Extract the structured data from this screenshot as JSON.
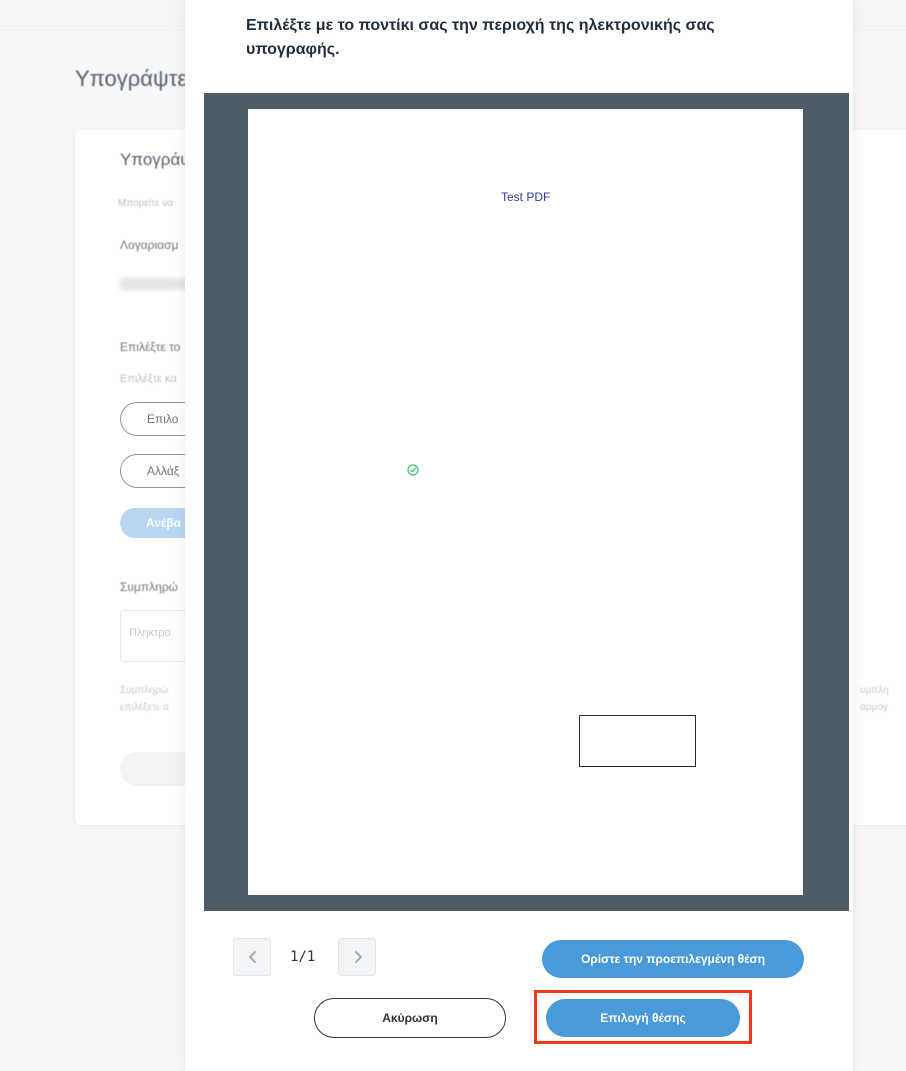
{
  "background": {
    "page_title": "Υπογράψτε",
    "card_heading": "Υπογράψ",
    "card_subtitle": "Μπορείτε να",
    "account_label": "Λογαριασμ",
    "select_label": "Επιλέξτε το",
    "select_sublabel": "Επιλέξτε κα",
    "btn_select": "Επιλο",
    "btn_change": "Αλλάξ",
    "btn_upload": "Ανέβα",
    "complete_label": "Συμπληρώ",
    "input_placeholder": "Πληκτρο",
    "para_line1": "Συμπληρώ",
    "para_line2": "επιλέξετε α",
    "right_para_line1": "υμπλη",
    "right_para_line2": "αρμογ"
  },
  "modal": {
    "title": "Επιλέξτε με το ποντίκι σας την περιοχή της ηλεκτρονικής σας υπογραφής.",
    "pdf_text": "Test PDF",
    "page_indicator": "1/1",
    "default_position_button": "Ορίστε την προεπιλεγμένη θέση",
    "cancel_button": "Ακύρωση",
    "select_position_button": "Επιλογή θέσης"
  },
  "icons": {
    "prev": "chevron-left-icon",
    "next": "chevron-right-icon",
    "check": "check-circle-icon"
  },
  "colors": {
    "primary": "#4a9ad9",
    "viewer_bg": "#4e5c67",
    "highlight": "#f03a17",
    "check_green": "#3cc46a"
  }
}
